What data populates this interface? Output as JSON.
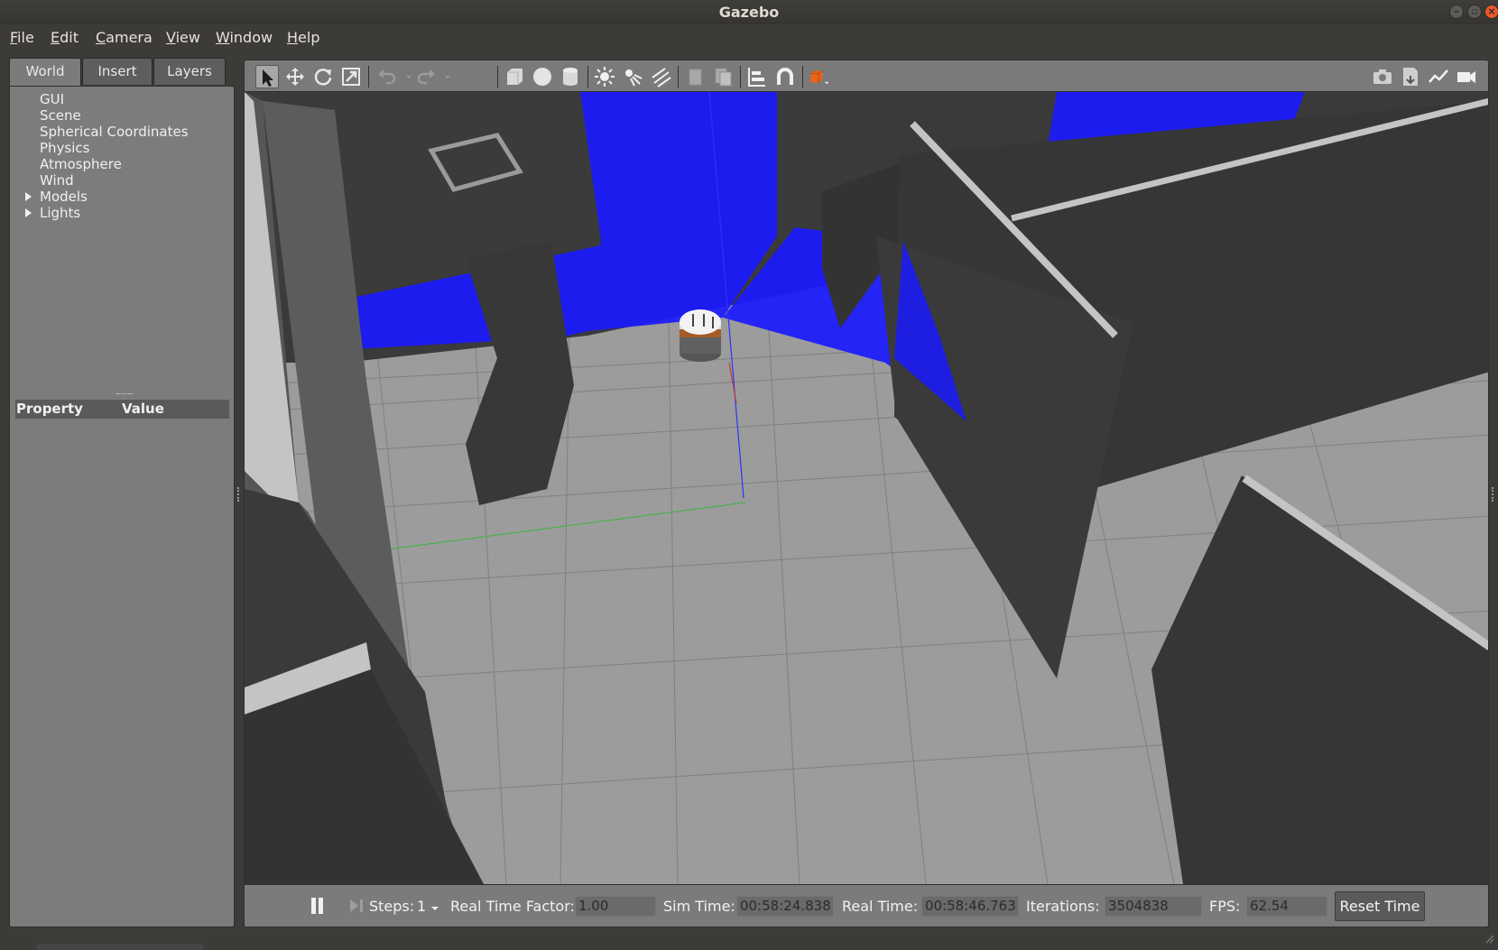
{
  "window": {
    "title": "Gazebo"
  },
  "menubar": {
    "items": [
      {
        "label_u": "F",
        "label_rest": "ile"
      },
      {
        "label_u": "E",
        "label_rest": "dit"
      },
      {
        "label_u": "C",
        "label_rest": "amera"
      },
      {
        "label_u": "V",
        "label_rest": "iew"
      },
      {
        "label_u": "W",
        "label_rest": "indow"
      },
      {
        "label_u": "H",
        "label_rest": "elp"
      }
    ]
  },
  "left_panel": {
    "tabs": [
      {
        "label": "World",
        "active": true
      },
      {
        "label": "Insert",
        "active": false
      },
      {
        "label": "Layers",
        "active": false
      }
    ],
    "tree": [
      {
        "label": "GUI",
        "expandable": false
      },
      {
        "label": "Scene",
        "expandable": false
      },
      {
        "label": "Spherical Coordinates",
        "expandable": false
      },
      {
        "label": "Physics",
        "expandable": false
      },
      {
        "label": "Atmosphere",
        "expandable": false
      },
      {
        "label": "Wind",
        "expandable": false
      },
      {
        "label": "Models",
        "expandable": true
      },
      {
        "label": "Lights",
        "expandable": true
      }
    ],
    "property_header": {
      "property": "Property",
      "value": "Value"
    }
  },
  "toolbar": {
    "tools": [
      {
        "icon": "select-arrow-icon",
        "active": true
      },
      {
        "icon": "translate-icon"
      },
      {
        "icon": "rotate-icon"
      },
      {
        "icon": "scale-icon"
      },
      {
        "icon": "undo-icon"
      },
      {
        "icon": "redo-icon"
      },
      {
        "icon": "box-shape-icon"
      },
      {
        "icon": "sphere-shape-icon"
      },
      {
        "icon": "cylinder-shape-icon"
      },
      {
        "icon": "point-light-icon"
      },
      {
        "icon": "spot-light-icon"
      },
      {
        "icon": "directional-light-icon"
      },
      {
        "icon": "copy-icon"
      },
      {
        "icon": "paste-icon"
      },
      {
        "icon": "align-icon"
      },
      {
        "icon": "snap-icon"
      },
      {
        "icon": "change-view-icon"
      }
    ],
    "right_tools": [
      {
        "icon": "screenshot-camera-icon"
      },
      {
        "icon": "log-icon"
      },
      {
        "icon": "plot-icon"
      },
      {
        "icon": "video-record-icon"
      }
    ],
    "colors": {
      "view_cube": "#e8641a",
      "toolbar_bg": "#7a7a7a"
    }
  },
  "viewport": {
    "colors": {
      "ground": "#9c9c9c",
      "wall_top": "#3a3a3a",
      "wall_side": "#565656",
      "wall_edge": "#c4c4c4",
      "laser": "#1414ff",
      "grid": "#7e7e7e"
    }
  },
  "bottom_bar": {
    "steps_label": "Steps:",
    "steps_value": "1",
    "rtf_label": "Real Time Factor:",
    "rtf_value": "1.00",
    "sim_time_label": "Sim Time:",
    "sim_time_value": "00:58:24.838",
    "real_time_label": "Real Time:",
    "real_time_value": "00:58:46.763",
    "iterations_label": "Iterations:",
    "iterations_value": "3504838",
    "fps_label": "FPS:",
    "fps_value": "62.54",
    "reset_label": "Reset Time"
  }
}
